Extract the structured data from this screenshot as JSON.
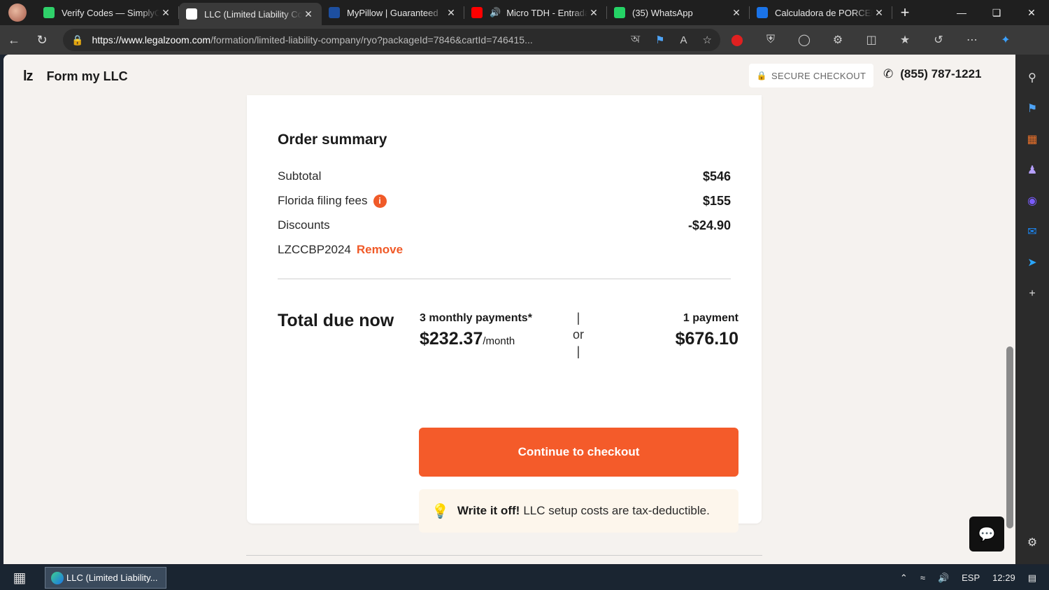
{
  "browser": {
    "tabs": [
      {
        "title": "Verify Codes — SimplyCodes",
        "favicon": "simplycodes-icon",
        "color": "#2fd16a"
      },
      {
        "title": "LLC (Limited Liability Company)",
        "favicon": "legalzoom-icon",
        "color": "#ffffff",
        "active": true
      },
      {
        "title": "MyPillow | Guaranteed",
        "favicon": "mypillow-icon",
        "color": "#1d4fa0"
      },
      {
        "title": "Micro TDH - Entrada",
        "favicon": "youtube-icon",
        "color": "#ff0000",
        "audio": true
      },
      {
        "title": "(35) WhatsApp",
        "favicon": "whatsapp-icon",
        "color": "#25d366"
      },
      {
        "title": "Calculadora de PORCENTAJES",
        "favicon": "calculator-icon",
        "color": "#1a73e8"
      }
    ],
    "url_host": "https://www.legalzoom.com",
    "url_path": "/formation/limited-liability-company/ryo?packageId=7846&cartId=746415...",
    "new_tab_label": "+"
  },
  "site": {
    "logo": "lz",
    "title": "Form my LLC",
    "secure_label": "SECURE CHECKOUT",
    "phone": "(855) 787-1221"
  },
  "summary": {
    "heading": "Order summary",
    "subtotal_label": "Subtotal",
    "subtotal_value": "$546",
    "fees_label": "Florida filing fees",
    "fees_value": "$155",
    "discounts_label": "Discounts",
    "discounts_value": "-$24.90",
    "promo_code": "LZCCBP2024",
    "remove_label": "Remove",
    "total_label": "Total due now",
    "monthly_label": "3 monthly payments*",
    "monthly_value": "$232.37",
    "monthly_unit": "/month",
    "separator_top": "|",
    "or_label": "or",
    "separator_bottom": "|",
    "single_label": "1 payment",
    "single_value": "$676.10",
    "cta_label": "Continue to checkout",
    "tip_bold": "Write it off!",
    "tip_text": "LLC setup costs are tax-deductible."
  },
  "taskbar": {
    "app_label": "LLC (Limited Liability...",
    "language": "ESP",
    "time": "12:29"
  },
  "colors": {
    "accent": "#f45b2a",
    "page_bg": "#f5f2ef"
  }
}
